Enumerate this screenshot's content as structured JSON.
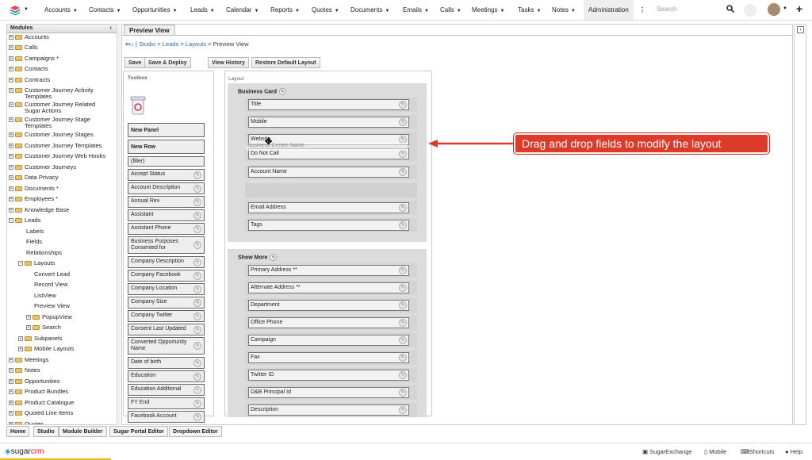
{
  "topnav": {
    "items": [
      {
        "label": "Accounts"
      },
      {
        "label": "Contacts"
      },
      {
        "label": "Opportunities"
      },
      {
        "label": "Leads"
      },
      {
        "label": "Calendar"
      },
      {
        "label": "Reports"
      },
      {
        "label": "Quotes"
      },
      {
        "label": "Documents"
      },
      {
        "label": "Emails"
      },
      {
        "label": "Calls"
      },
      {
        "label": "Meetings"
      },
      {
        "label": "Tasks"
      },
      {
        "label": "Notes"
      }
    ],
    "active": "Administration",
    "more": "⋮",
    "search_placeholder": "Search"
  },
  "sidebar": {
    "title": "Modules",
    "collapse": "‹",
    "items": [
      {
        "label": "Accounts"
      },
      {
        "label": "Calls"
      },
      {
        "label": "Campaigns *"
      },
      {
        "label": "Contacts"
      },
      {
        "label": "Contracts"
      },
      {
        "label": "Customer Journey Activity Templates"
      },
      {
        "label": "Customer Journey Related Sugar Actions"
      },
      {
        "label": "Customer Journey Stage Templates"
      },
      {
        "label": "Customer Journey Stages"
      },
      {
        "label": "Customer Journey Templates"
      },
      {
        "label": "Customer Journey Web Hooks"
      },
      {
        "label": "Customer Journeys"
      },
      {
        "label": "Data Privacy"
      },
      {
        "label": "Documents *"
      },
      {
        "label": "Employees *"
      },
      {
        "label": "Knowledge Base"
      },
      {
        "label": "Leads"
      },
      {
        "label": "Labels"
      },
      {
        "label": "Fields"
      },
      {
        "label": "Relationships"
      },
      {
        "label": "Layouts"
      },
      {
        "label": "Convert Lead"
      },
      {
        "label": "Record View"
      },
      {
        "label": "ListView"
      },
      {
        "label": "Preview View"
      },
      {
        "label": "PopupView"
      },
      {
        "label": "Search"
      },
      {
        "label": "Subpanels"
      },
      {
        "label": "Mobile Layouts"
      },
      {
        "label": "Meetings"
      },
      {
        "label": "Notes"
      },
      {
        "label": "Opportunities"
      },
      {
        "label": "Product Bundles"
      },
      {
        "label": "Product Catalogue"
      },
      {
        "label": "Quoted Line Items"
      },
      {
        "label": "Quotes"
      }
    ]
  },
  "main": {
    "tab": "Preview View",
    "breadcrumb": {
      "sep": " | ",
      "studio": "Studio",
      "gt1": " > ",
      "leads": "Leads",
      "gt2": " > ",
      "layouts": "Layouts",
      "gt3": " > ",
      "current": "Preview View"
    },
    "buttons": {
      "save": "Save",
      "save_deploy": "Save & Deploy",
      "view_history": "View History",
      "restore": "Restore Default Layout"
    },
    "toolbox": {
      "title": "Toolbox",
      "new_panel": "New Panel",
      "new_row": "New Row",
      "filler": "(filler)",
      "fields": [
        "Accept Status",
        "Account Description",
        "Annual Rev",
        "Assistant",
        "Assistant Phone",
        "Business Purposes Consented for",
        "Company Description",
        "Company Facebook",
        "Company Location",
        "Company Size",
        "Company Twitter",
        "Consent Last Updated",
        "Converted Opportunity Name",
        "Date of birth",
        "Education",
        "Education Additional",
        "FY End",
        "Facebook Account"
      ]
    },
    "layout": {
      "title": "Layout",
      "panels": [
        {
          "name": "Business Card",
          "fields": [
            "Title",
            "Mobile",
            "Website",
            "Do Not Call",
            "Account Name",
            "",
            "Email Address",
            "Tags"
          ]
        },
        {
          "name": "Show More",
          "fields": [
            "Primary Address **",
            "Alternate Address **",
            "Department",
            "Office Phone",
            "Campaign",
            "Fax",
            "Twitter ID",
            "D&B Principal Id",
            "Description"
          ]
        }
      ],
      "dragging": "Business Centre Name"
    }
  },
  "callout": "Drag and drop fields to modify the layout",
  "bottom_tabs": [
    "Home",
    "Studio",
    "Module Builder",
    "Sugar Portal Editor",
    "Dropdown Editor"
  ],
  "footer": {
    "brand1": "sugar",
    "brand2": "crm",
    "links": [
      "SugarExchange",
      "Mobile",
      "Shortcuts",
      "Help"
    ]
  },
  "colors": {
    "callout": "#dd3b2a",
    "folder": "#e8c463",
    "link": "#3366cc"
  }
}
